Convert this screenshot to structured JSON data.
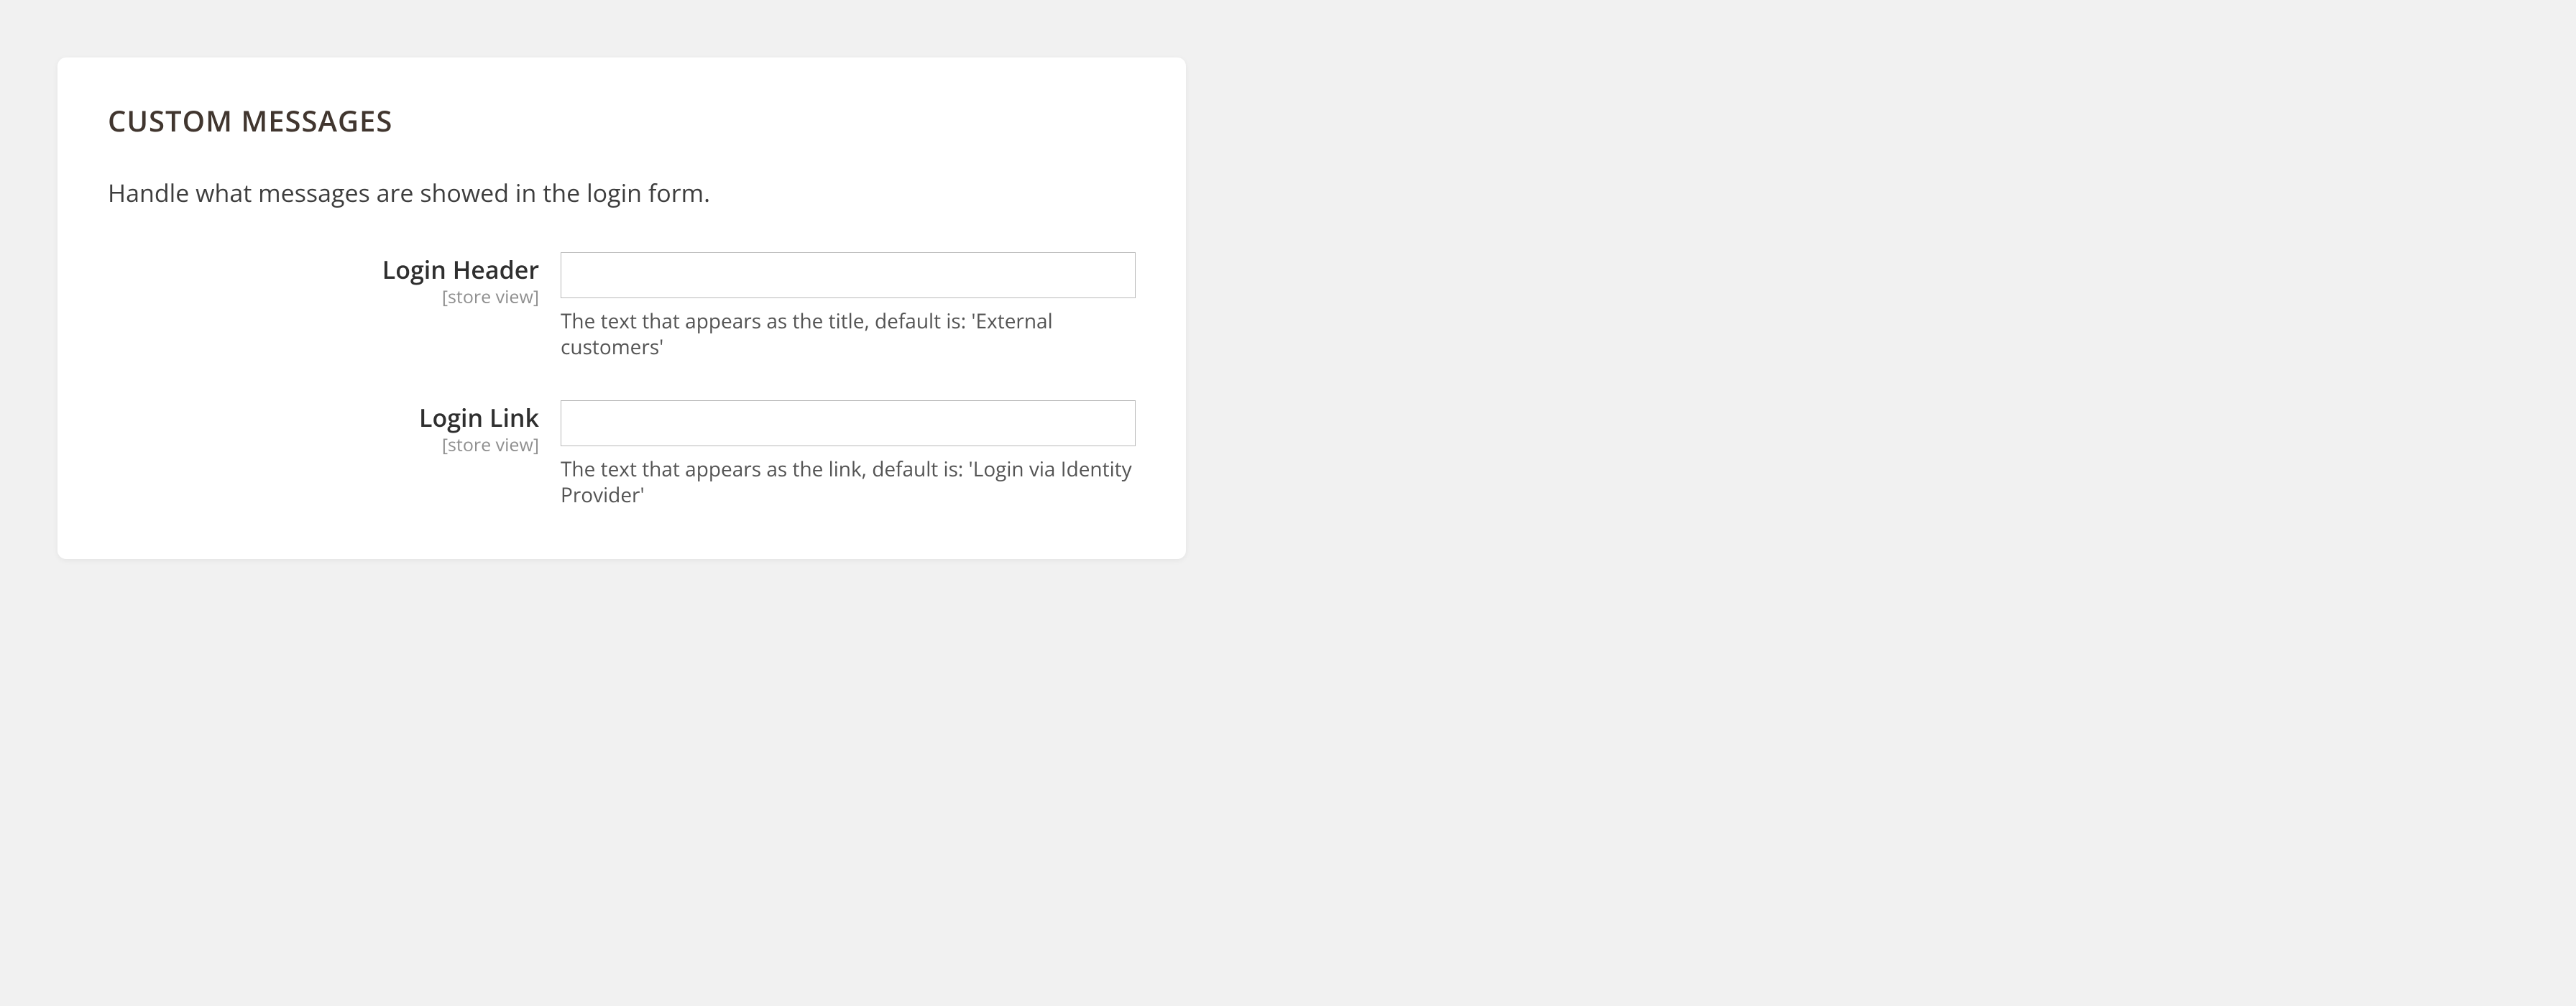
{
  "section": {
    "title": "CUSTOM MESSAGES",
    "description": "Handle what messages are showed in the login form."
  },
  "fields": {
    "login_header": {
      "label": "Login Header",
      "scope": "[store view]",
      "value": "",
      "hint": "The text that appears as the title, default is: 'External customers'"
    },
    "login_link": {
      "label": "Login Link",
      "scope": "[store view]",
      "value": "",
      "hint": "The text that appears as the link, default is: 'Login via Identity Provider'"
    }
  }
}
